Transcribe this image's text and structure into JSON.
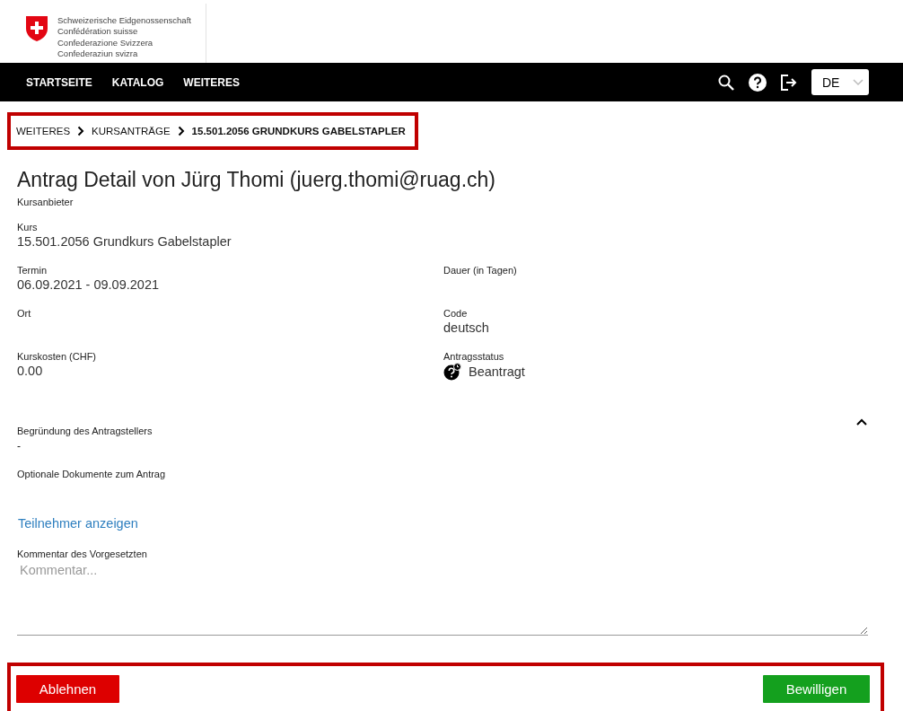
{
  "header": {
    "logo_lines": [
      "Schweizerische Eidgenossenschaft",
      "Confédération suisse",
      "Confederazione Svizzera",
      "Confederaziun svizra"
    ]
  },
  "nav": {
    "items": [
      "STARTSEITE",
      "KATALOG",
      "WEITERES"
    ],
    "language": "DE"
  },
  "breadcrumb": [
    {
      "label": "WEITERES",
      "current": false
    },
    {
      "label": "KURSANTRÄGE",
      "current": false
    },
    {
      "label": "15.501.2056 GRUNDKURS GABELSTAPLER",
      "current": true
    }
  ],
  "title": "Antrag Detail von Jürg Thomi (juerg.thomi@ruag.ch)",
  "detail_rows": [
    [
      {
        "label": "Kursanbieter"
      }
    ],
    [
      {
        "label": "Kurs",
        "value": "15.501.2056 Grundkurs Gabelstapler"
      }
    ],
    [
      {
        "label": "Termin",
        "value": "06.09.2021 - 09.09.2021"
      },
      {
        "label": "Dauer (in Tagen)"
      }
    ],
    [
      {
        "label": "Ort"
      },
      {
        "label": "Code",
        "value": "deutsch"
      }
    ],
    [
      {
        "label": "Kurskosten (CHF)",
        "value": "0.00"
      },
      {
        "label": "Antragsstatus",
        "value": "Beantragt",
        "kind": "status"
      }
    ]
  ],
  "reason": {
    "label": "Begründung des Antragstellers",
    "value": "-",
    "expanded": true
  },
  "documents": {
    "label": "Optionale Dokumente zum Antrag"
  },
  "participants_link": "Teilnehmer anzeigen",
  "comment": {
    "label": "Kommentar des Vorgesetzten",
    "placeholder": "Kommentar..."
  },
  "actions": [
    {
      "label": "Ablehnen",
      "kind": "reject"
    },
    {
      "label": "Bewilligen",
      "kind": "approve"
    }
  ]
}
